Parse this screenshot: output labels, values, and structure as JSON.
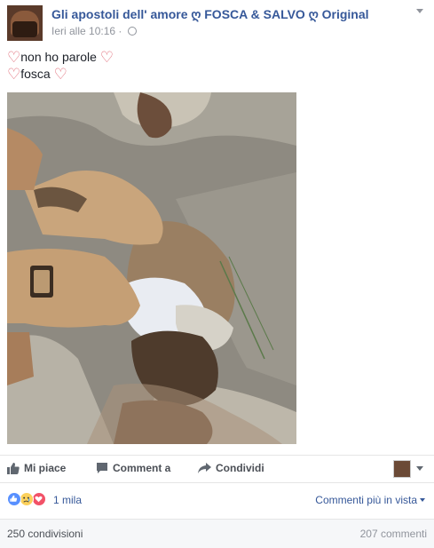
{
  "post": {
    "page_name": "Gli apostoli dell' amore ღ FOSCA & SALVO ღ Original",
    "timestamp": "Ieri alle 10:16",
    "separator": "·",
    "privacy_icon": "globe-icon",
    "lines": [
      {
        "heart_left": "♡",
        "text": "non ho parole",
        "heart_right": "♡"
      },
      {
        "heart_left": "♡",
        "text": "fosca",
        "heart_right": "♡"
      }
    ]
  },
  "actions": {
    "like_label": "Mi piace",
    "comment_label": "Comment a",
    "share_label": "Condividi"
  },
  "reactions": {
    "count_label": "1 mila",
    "icons": [
      "like-reaction-icon",
      "sad-reaction-icon",
      "love-reaction-icon"
    ],
    "sort_label": "Commenti più in vista"
  },
  "stats": {
    "shares": "250 condivisioni",
    "comments": "207 commenti"
  },
  "colors": {
    "link": "#365899",
    "like_blue": "#5890ff",
    "love_red": "#f25268",
    "sad_yellow": "#fcd15c"
  }
}
